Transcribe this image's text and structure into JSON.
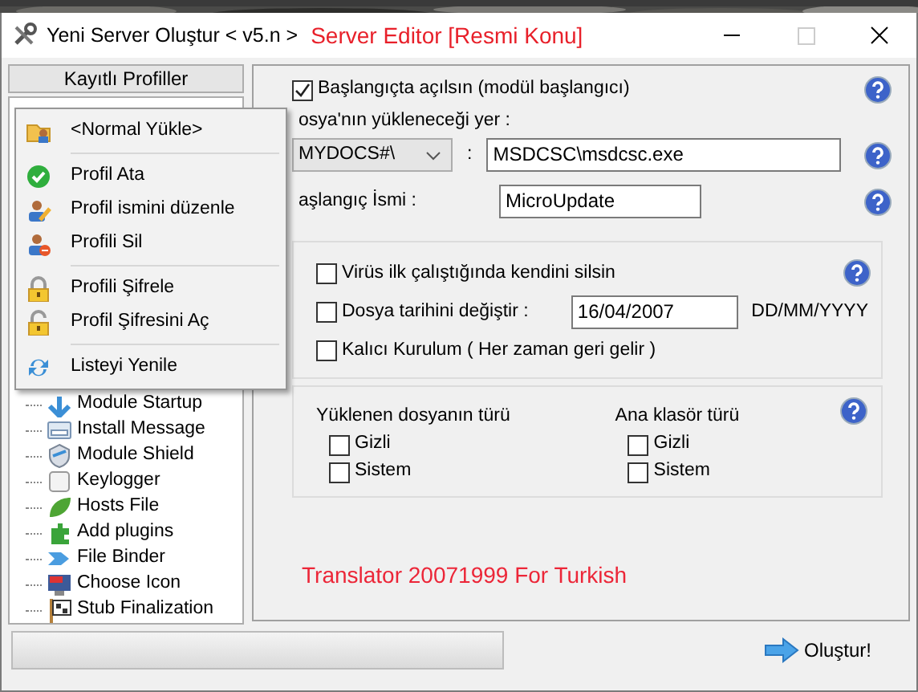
{
  "window": {
    "title": "Yeni Server Oluştur < v5.n >",
    "subtitle": "Server Editor [Resmi Konu]"
  },
  "sidebar": {
    "header": "Kayıtlı Profiller",
    "items": [
      {
        "label": "Module Startup"
      },
      {
        "label": "Install Message"
      },
      {
        "label": "Module Shield"
      },
      {
        "label": "Keylogger"
      },
      {
        "label": "Hosts File"
      },
      {
        "label": "Add plugins"
      },
      {
        "label": "File Binder"
      },
      {
        "label": "Choose Icon"
      },
      {
        "label": "Stub Finalization"
      }
    ]
  },
  "context_menu": {
    "groups": [
      [
        {
          "label": "<Normal Yükle>"
        }
      ],
      [
        {
          "label": "Profil Ata"
        },
        {
          "label": "Profil ismini düzenle"
        },
        {
          "label": "Profili Sil"
        }
      ],
      [
        {
          "label": "Profili Şifrele"
        },
        {
          "label": "Profil Şifresini Aç"
        }
      ],
      [
        {
          "label": "Listeyi Yenile"
        }
      ]
    ]
  },
  "startup": {
    "label": "Başlangıçta açılsın (modül başlangıcı)",
    "checked": true
  },
  "location": {
    "label": "osya'nın yükleneceği yer :",
    "folder": "MYDOCS#\\",
    "separator": ":",
    "path": "MSDCSC\\msdcsc.exe"
  },
  "startup_name": {
    "label": "aşlangıç İsmi :",
    "value": "MicroUpdate"
  },
  "options": [
    {
      "kind": "check",
      "label": "Virüs ilk çalıştığında kendini silsin",
      "checked": false
    },
    {
      "kind": "date",
      "label": "Dosya tarihini değiştir :",
      "checked": false,
      "value": "16/04/2007",
      "format": "DD/MM/YYYY"
    },
    {
      "kind": "check",
      "label": "Kalıcı Kurulum ( Her zaman geri gelir )",
      "checked": false
    }
  ],
  "attributes": [
    {
      "title": "Yüklenen dosyanın türü",
      "items": [
        {
          "label": "Gizli",
          "checked": false
        },
        {
          "label": "Sistem",
          "checked": false
        }
      ]
    },
    {
      "title": "Ana klasör türü",
      "items": [
        {
          "label": "Gizli",
          "checked": false
        },
        {
          "label": "Sistem",
          "checked": false
        }
      ]
    }
  ],
  "credit": "Translator 20071999 For Turkish",
  "progress": {
    "level": 0
  },
  "build_button": "Oluştur!"
}
